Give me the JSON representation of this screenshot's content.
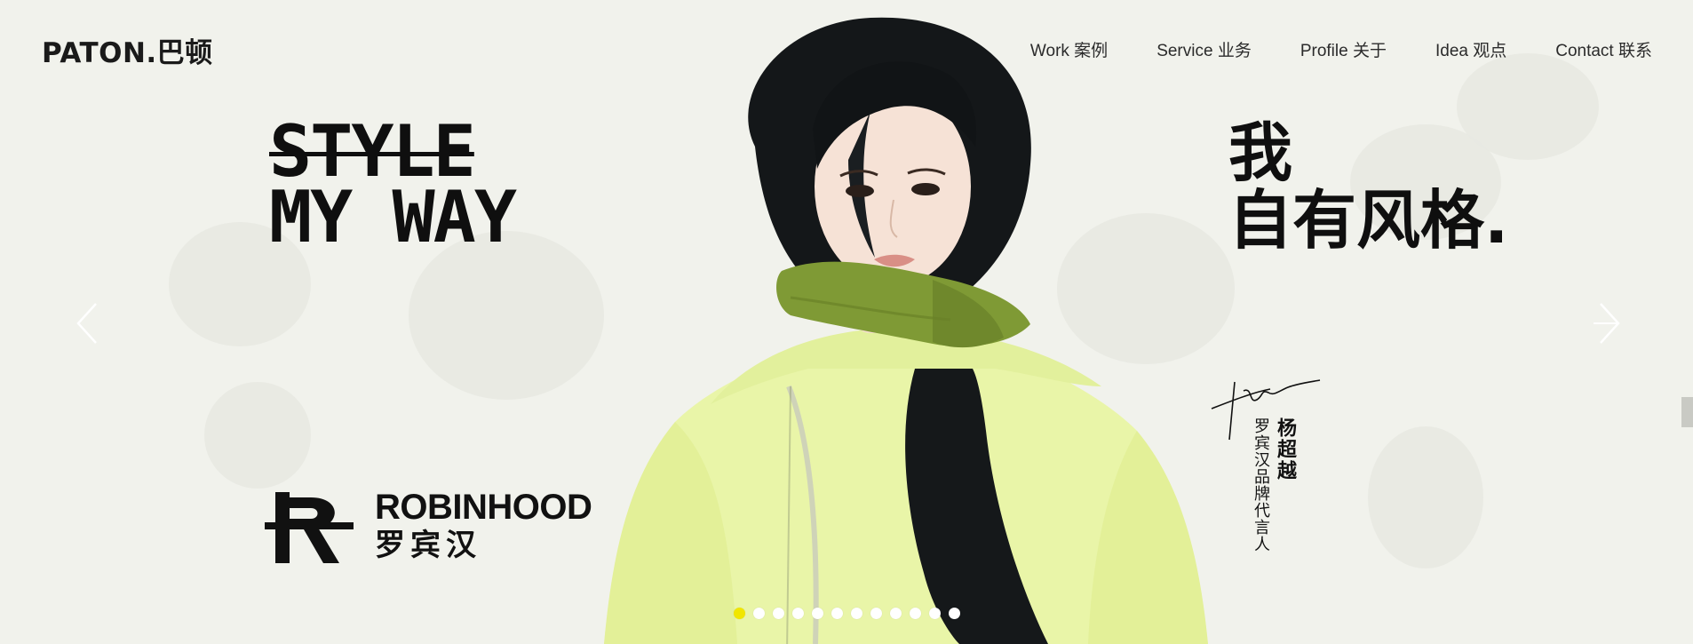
{
  "header": {
    "logo_text": "PATON.巴顿",
    "nav": [
      {
        "label": "Work 案例"
      },
      {
        "label": "Service 业务"
      },
      {
        "label": "Profile 关于"
      },
      {
        "label": "Idea 观点"
      },
      {
        "label": "Contact 联系"
      }
    ]
  },
  "slide": {
    "headline_left": {
      "line1": "STYLE",
      "line2": "MY WAY"
    },
    "headline_right": {
      "line1": "我",
      "line2": "自有风格."
    },
    "brand": {
      "name_en": "ROBINHOOD",
      "name_cn": "罗宾汉"
    },
    "ambassador": {
      "name": "杨超越",
      "title": "罗宾汉品牌代言人"
    }
  },
  "carousel": {
    "prev_icon": "chevron-left-icon",
    "next_icon": "chevron-right-icon",
    "dots": [
      {
        "active": true
      },
      {
        "active": false
      },
      {
        "active": false
      },
      {
        "active": false
      },
      {
        "active": false
      },
      {
        "active": false
      },
      {
        "active": false
      },
      {
        "active": false
      },
      {
        "active": false
      },
      {
        "active": false
      },
      {
        "active": false
      },
      {
        "active": false
      }
    ],
    "active_index": 0
  },
  "colors": {
    "background": "#f1f2ec",
    "text": "#111111",
    "active_dot": "#f1e600",
    "jacket": "#e9f5a8",
    "scarf": "#7f9a35"
  }
}
